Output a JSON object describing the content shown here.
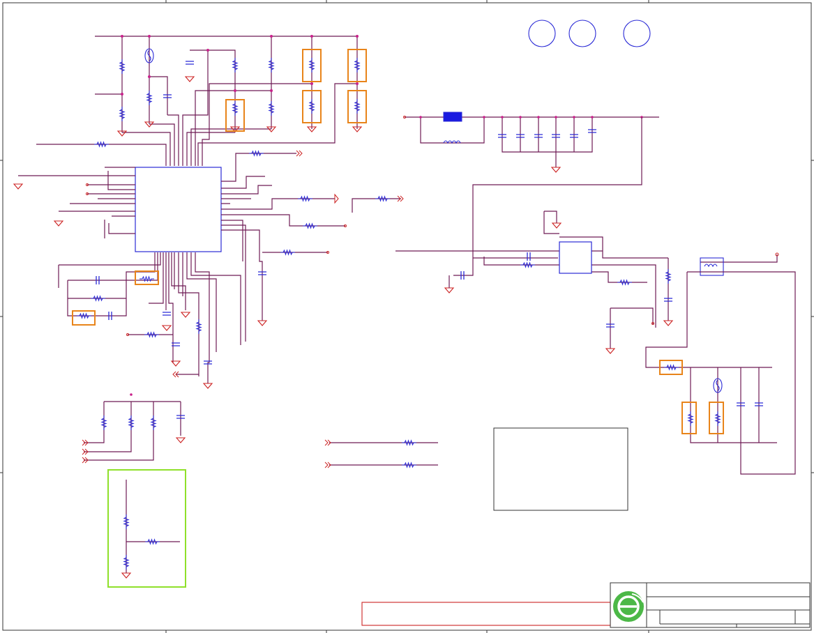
{
  "colors": {
    "wire": "#6e1a55",
    "ground": "#cc2222",
    "component": "#2a2ad6",
    "highlight_orange": "#e8841a",
    "highlight_green": "#8fe02a",
    "logo_green": "#4cb847",
    "fuse_fill": "#1a1ae0"
  },
  "icons": {
    "logo": "company-logo-icon"
  },
  "title_block": {
    "title": "",
    "sheet": ""
  }
}
